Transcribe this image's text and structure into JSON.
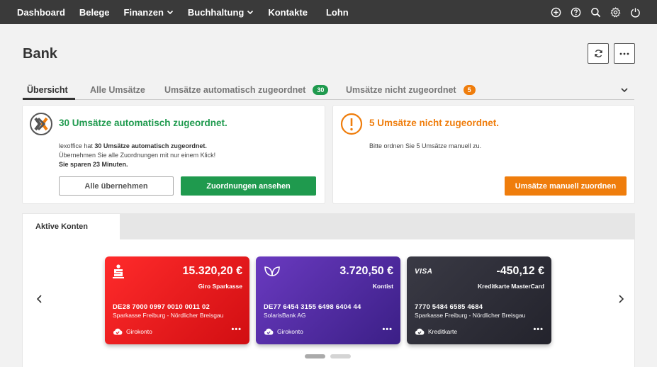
{
  "nav": {
    "items": [
      {
        "label": "Dashboard",
        "dropdown": false
      },
      {
        "label": "Belege",
        "dropdown": false
      },
      {
        "label": "Finanzen",
        "dropdown": true
      },
      {
        "label": "Buchhaltung",
        "dropdown": true
      },
      {
        "label": "Kontakte",
        "dropdown": false
      },
      {
        "label": "Lohn",
        "dropdown": false
      }
    ],
    "icons": [
      "plus-circle-icon",
      "help-icon",
      "search-icon",
      "gear-icon",
      "power-icon"
    ]
  },
  "page": {
    "title": "Bank"
  },
  "tabs": {
    "items": [
      {
        "label": "Übersicht",
        "active": true,
        "badge": ""
      },
      {
        "label": "Alle Umsätze",
        "active": false,
        "badge": ""
      },
      {
        "label": "Umsätze automatisch zugeordnet",
        "active": false,
        "badge": "30"
      },
      {
        "label": "Umsätze nicht zugeordnet",
        "active": false,
        "badge": "5"
      }
    ]
  },
  "auto_panel": {
    "title": "30 Umsätze automatisch zugeordnet.",
    "line1_pre": "lexoffice hat ",
    "line1_bold": "30 Umsätze automatisch zugeordnet.",
    "line2": "Übernehmen Sie alle Zuordnungen mit nur einem Klick!",
    "line3": "Sie sparen 23 Minuten.",
    "btn_accept_all": "Alle übernehmen",
    "btn_view": "Zuordnungen ansehen"
  },
  "unassigned_panel": {
    "title": "5 Umsätze nicht zugeordnet.",
    "body": "Bitte ordnen Sie 5 Umsätze manuell zu.",
    "btn_assign": "Umsätze manuell zuordnen"
  },
  "accounts": {
    "tab_label": "Aktive Konten",
    "cards": [
      {
        "amount": "15.320,20 €",
        "name": "Giro Sparkasse",
        "iban": "DE28 7000 0997 0010 0011 02",
        "bank": "Sparkasse Freiburg - Nördlicher Breisgau",
        "type": "Girokonto",
        "logo": "sparkasse-logo"
      },
      {
        "amount": "3.720,50 €",
        "name": "Kontist",
        "iban": "DE77 6454 3155 6498 6404 44",
        "bank": "SolarisBank AG",
        "type": "Girokonto",
        "logo": "kontist-leaf-logo"
      },
      {
        "amount": "-450,12 €",
        "name": "Kreditkarte MasterCard",
        "iban": "7770 5484 6585 4684",
        "bank": "Sparkasse Freiburg - Nördlicher Breisgau",
        "type": "Kreditkarte",
        "logo": "visa-logo",
        "logo_text": "VISA"
      }
    ],
    "dots_label": "•••",
    "pages": 2,
    "current_page": 1
  },
  "colors": {
    "nav_bg": "#3a3a3a",
    "green": "#1f9a4e",
    "orange": "#ef7d0c",
    "card_red": "#e8161a",
    "card_purple": "#5530a8",
    "card_dark": "#2c2c36"
  }
}
